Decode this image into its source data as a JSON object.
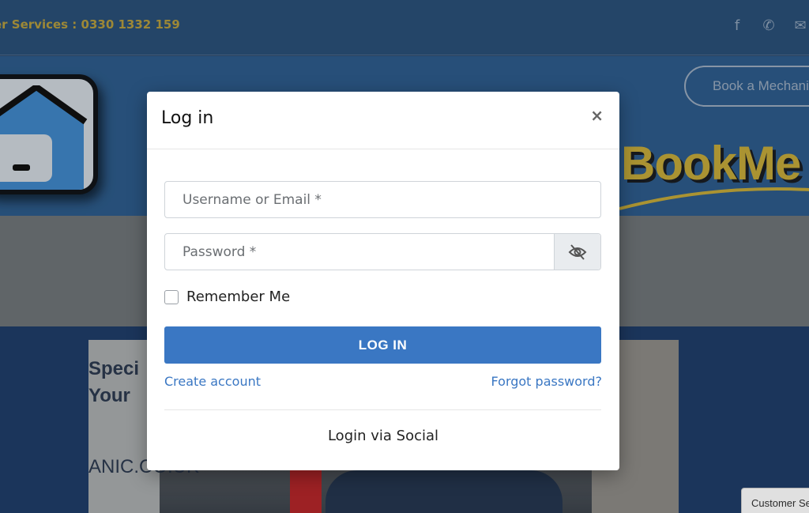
{
  "background": {
    "topbar": {
      "phone_text": "er Services : 0330 1332 159",
      "social_icons": [
        "facebook-icon",
        "whatsapp-icon",
        "mail-icon"
      ]
    },
    "book_button": "Book a Mechani",
    "brand_text": "BookMe",
    "photo_text": [
      "Speci",
      "Your",
      "ANIC.CO.UK"
    ],
    "customer_service_tab": "Customer Se"
  },
  "modal": {
    "title": "Log in",
    "close_label": "×",
    "username_placeholder": "Username or Email *",
    "password_placeholder": "Password *",
    "remember_label": "Remember Me",
    "login_button": "LOG IN",
    "create_account": "Create account",
    "forgot_password": "Forgot password?",
    "social_login": "Login via Social"
  },
  "colors": {
    "primary": "#3a77c3",
    "header_bg": "#2d5b8a",
    "brand_gold": "#c2a83a"
  }
}
